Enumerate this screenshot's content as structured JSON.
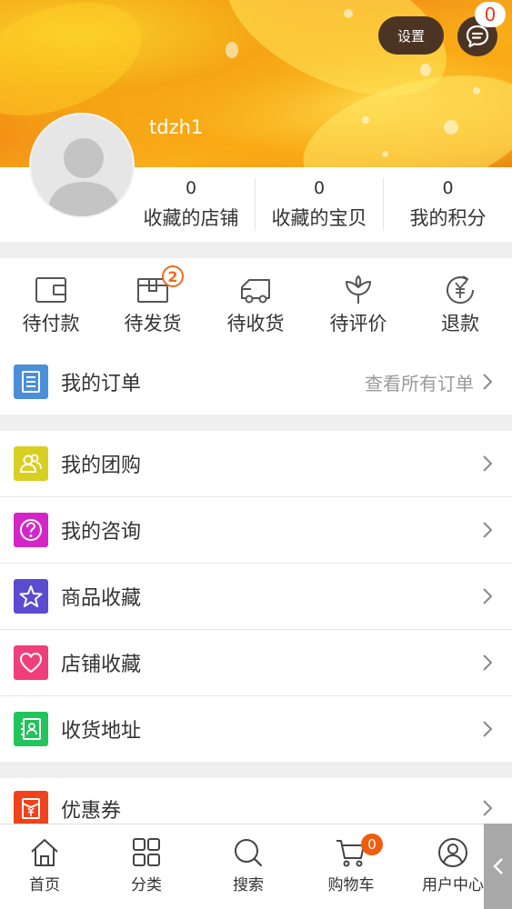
{
  "header": {
    "settings_label": "设置",
    "message_count": "0",
    "username": "tdzh1"
  },
  "stats": [
    {
      "value": "0",
      "label": "收藏的店铺"
    },
    {
      "value": "0",
      "label": "收藏的宝贝"
    },
    {
      "value": "0",
      "label": "我的积分"
    }
  ],
  "order_status": [
    {
      "label": "待付款",
      "icon": "wallet-icon"
    },
    {
      "label": "待发货",
      "icon": "package-icon",
      "badge": "2"
    },
    {
      "label": "待收货",
      "icon": "truck-icon"
    },
    {
      "label": "待评价",
      "icon": "flower-icon"
    },
    {
      "label": "退款",
      "icon": "refund-icon"
    }
  ],
  "my_orders": {
    "label": "我的订单",
    "link": "查看所有订单",
    "icon_color": "#4b8fd9"
  },
  "menu": [
    {
      "label": "我的团购",
      "icon": "group-icon",
      "color": "#d9cf22"
    },
    {
      "label": "我的咨询",
      "icon": "question-icon",
      "color": "#d426c8"
    },
    {
      "label": "商品收藏",
      "icon": "star-icon",
      "color": "#5a4bd0"
    },
    {
      "label": "店铺收藏",
      "icon": "heart-icon",
      "color": "#ef3f7a"
    },
    {
      "label": "收货地址",
      "icon": "address-icon",
      "color": "#22c45c"
    }
  ],
  "coupon": {
    "label": "优惠券",
    "icon": "coupon-icon",
    "color": "#f0421c"
  },
  "tabbar": [
    {
      "label": "首页",
      "icon": "home-icon"
    },
    {
      "label": "分类",
      "icon": "category-icon"
    },
    {
      "label": "搜索",
      "icon": "search-icon"
    },
    {
      "label": "购物车",
      "icon": "cart-icon",
      "badge": "0"
    },
    {
      "label": "用户中心",
      "icon": "user-icon"
    }
  ]
}
